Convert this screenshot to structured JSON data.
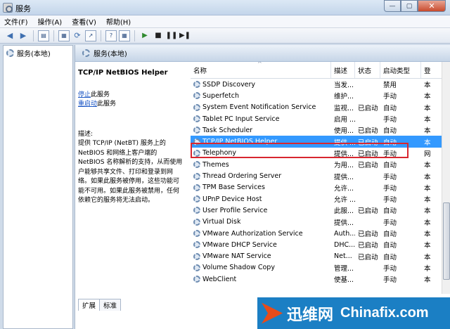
{
  "window": {
    "title": "服务"
  },
  "menu": [
    "文件(F)",
    "操作(A)",
    "查看(V)",
    "帮助(H)"
  ],
  "nav": {
    "item": "服务(本地)"
  },
  "panel": {
    "title": "服务(本地)"
  },
  "detail": {
    "service_name": "TCP/IP NetBIOS Helper",
    "stop_link": "停止",
    "stop_suffix": "此服务",
    "restart_link": "重启动",
    "restart_suffix": "此服务",
    "desc_label": "描述:",
    "desc_lines": [
      "提供 TCP/IP (NetBT) 服务上的",
      "NetBIOS 和网络上客户端的",
      "NetBIOS 名称解析的支持，从而使用",
      "户能够共享文件、打印和登录到网",
      "络。如果此服务被停用，这些功能可",
      "能不可用。如果此服务被禁用，任何",
      "依赖它的服务将无法启动。"
    ]
  },
  "columns": {
    "name": "名称",
    "description": "描述",
    "status": "状态",
    "startup": "启动类型",
    "logon": "登"
  },
  "rows": [
    {
      "name": "SSDP Discovery",
      "description": "当发...",
      "status": "",
      "startup": "禁用",
      "logon": "本"
    },
    {
      "name": "Superfetch",
      "description": "维护...",
      "status": "",
      "startup": "手动",
      "logon": "本"
    },
    {
      "name": "System Event Notification Service",
      "description": "监视...",
      "status": "已启动",
      "startup": "自动",
      "logon": "本"
    },
    {
      "name": "Tablet PC Input Service",
      "description": "启用 ...",
      "status": "",
      "startup": "手动",
      "logon": "本"
    },
    {
      "name": "Task Scheduler",
      "description": "使用...",
      "status": "已启动",
      "startup": "自动",
      "logon": "本"
    },
    {
      "name": "TCP/IP NetBIOS Helper",
      "description": "提供 ...",
      "status": "已启动",
      "startup": "自动",
      "logon": "本",
      "selected": true
    },
    {
      "name": "Telephony",
      "description": "提供...",
      "status": "已启动",
      "startup": "手动",
      "logon": "网"
    },
    {
      "name": "Themes",
      "description": "为用...",
      "status": "已启动",
      "startup": "自动",
      "logon": "本"
    },
    {
      "name": "Thread Ordering Server",
      "description": "提供...",
      "status": "",
      "startup": "手动",
      "logon": "本"
    },
    {
      "name": "TPM Base Services",
      "description": "允许...",
      "status": "",
      "startup": "手动",
      "logon": "本"
    },
    {
      "name": "UPnP Device Host",
      "description": "允许 ...",
      "status": "",
      "startup": "手动",
      "logon": "本"
    },
    {
      "name": "User Profile Service",
      "description": "此服...",
      "status": "已启动",
      "startup": "自动",
      "logon": "本"
    },
    {
      "name": "Virtual Disk",
      "description": "提供...",
      "status": "",
      "startup": "手动",
      "logon": "本"
    },
    {
      "name": "VMware Authorization Service",
      "description": "Auth...",
      "status": "已启动",
      "startup": "自动",
      "logon": "本"
    },
    {
      "name": "VMware DHCP Service",
      "description": "DHC...",
      "status": "已启动",
      "startup": "自动",
      "logon": "本"
    },
    {
      "name": "VMware NAT Service",
      "description": "Net...",
      "status": "已启动",
      "startup": "自动",
      "logon": "本"
    },
    {
      "name": "Volume Shadow Copy",
      "description": "管理...",
      "status": "",
      "startup": "手动",
      "logon": "本"
    },
    {
      "name": "WebClient",
      "description": "使基...",
      "status": "",
      "startup": "手动",
      "logon": "本"
    }
  ],
  "tabs": [
    "扩展",
    "标准"
  ],
  "watermark": {
    "cn": "迅维网",
    "en": "Chinafix.com"
  },
  "icons": [
    "back-icon",
    "forward-icon",
    "console-tree-icon",
    "properties-icon",
    "refresh-icon",
    "export-icon",
    "help-icon",
    "view-icon",
    "start-icon",
    "stop-icon",
    "pause-icon",
    "restart-icon"
  ],
  "colors": {
    "selection": "#3399ff",
    "highlight_box": "#d8262f",
    "link": "#1a55c4",
    "watermark_bg": "#1b7fc4"
  }
}
